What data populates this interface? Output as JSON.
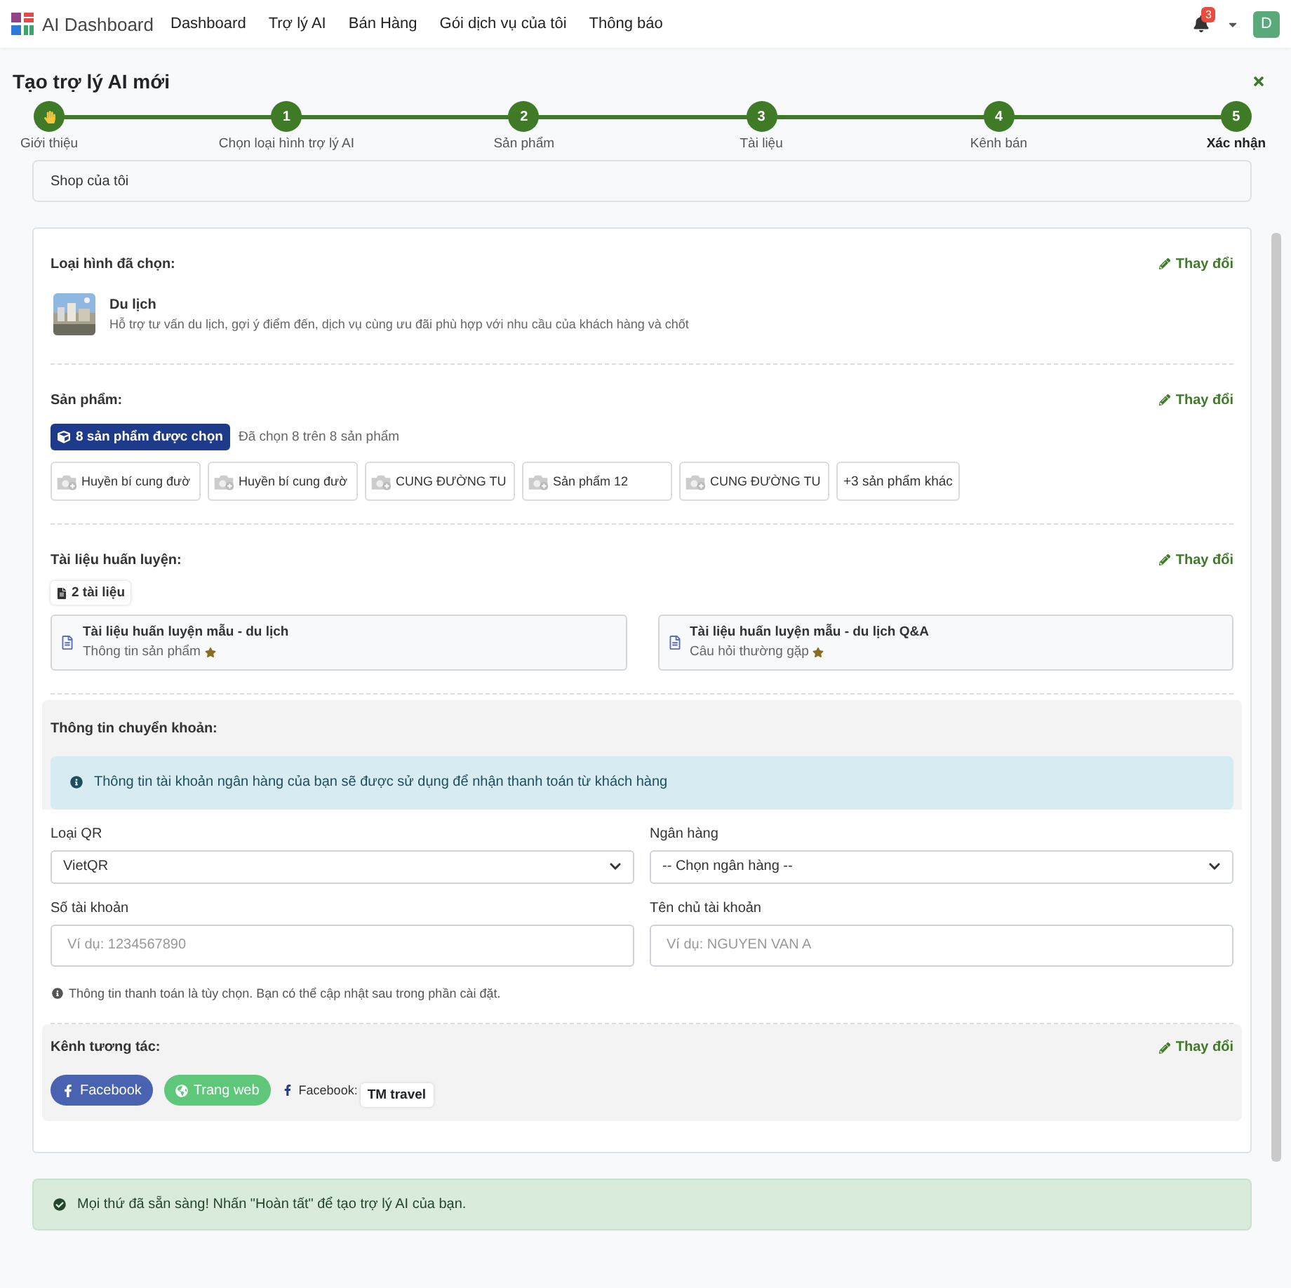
{
  "navbar": {
    "brand": "AI Dashboard",
    "links": [
      "Dashboard",
      "Trợ lý AI",
      "Bán Hàng",
      "Gói dịch vụ của tôi",
      "Thông báo"
    ],
    "notification_count": "3",
    "avatar": "D"
  },
  "page": {
    "title": "Tạo trợ lý AI mới"
  },
  "steps": [
    {
      "kind": "icon",
      "label": "Giới thiệu",
      "selected": false
    },
    {
      "kind": "number",
      "number": "1",
      "label": "Chọn loại hình trợ lý AI",
      "selected": false
    },
    {
      "kind": "number",
      "number": "2",
      "label": "Sản phẩm",
      "selected": false
    },
    {
      "kind": "number",
      "number": "3",
      "label": "Tài liệu",
      "selected": false
    },
    {
      "kind": "number",
      "number": "4",
      "label": "Kênh bán",
      "selected": false
    },
    {
      "kind": "number",
      "number": "5",
      "label": "Xác nhận",
      "selected": true
    }
  ],
  "store_name": {
    "value": "Shop của tôi"
  },
  "summary": {
    "assistant_type": {
      "title": "Loại hình đã chọn:",
      "edit": "Thay đổi",
      "name": "Du lịch",
      "description": "Hỗ trợ tư vấn du lịch, gợi ý điểm đến, dịch vụ cùng ưu đãi phù hợp với nhu cầu của khách hàng và chốt"
    },
    "products": {
      "title": "Sản phẩm:",
      "edit": "Thay đổi",
      "badge": "8 sản phẩm được chọn",
      "note": "Đã chọn 8 trên 8 sản phẩm",
      "items": [
        "Huyền bí cung đườ",
        "Huyền bí cung đườ",
        "CUNG ĐƯỜNG TU",
        "Sản phẩm 12",
        "CUNG ĐƯỜNG TU"
      ],
      "more": "+3 sản phẩm khác"
    },
    "documents": {
      "title": "Tài liệu huấn luyện:",
      "edit": "Thay đổi",
      "badge": "2 tài liệu",
      "items": [
        {
          "title": "Tài liệu huấn luyện mẫu - du lịch",
          "subtitle": "Thông tin sản phẩm"
        },
        {
          "title": "Tài liệu huấn luyện mẫu - du lịch Q&A",
          "subtitle": "Câu hỏi thường gặp"
        }
      ]
    },
    "payment": {
      "title": "Thông tin chuyển khoản:",
      "info": "Thông tin tài khoản ngân hàng của bạn sẽ được sử dụng để nhận thanh toán từ khách hàng",
      "fields": [
        {
          "kind": "select",
          "label": "Loại QR",
          "value": "VietQR"
        },
        {
          "kind": "select",
          "label": "Ngân hàng",
          "value": "-- Chọn ngân hàng --"
        },
        {
          "kind": "input",
          "label": "Số tài khoản",
          "placeholder": "Ví dụ: 1234567890"
        },
        {
          "kind": "input",
          "label": "Tên chủ tài khoản",
          "placeholder": "Ví dụ: NGUYEN VAN A"
        }
      ],
      "note": "Thông tin thanh toán là tùy chọn. Bạn có thể cập nhật sau trong phần cài đặt."
    },
    "channels": {
      "title": "Kênh tương tác:",
      "edit": "Thay đổi",
      "items": [
        {
          "kind": "facebook",
          "label": "Facebook"
        },
        {
          "kind": "website",
          "label": "Trang web"
        }
      ],
      "page_label": "Facebook:",
      "page_name": "TM travel"
    }
  },
  "alert": {
    "text": "Mọi thứ đã sẵn sàng! Nhấn \"Hoàn tất\" để tạo trợ lý AI của bạn."
  }
}
